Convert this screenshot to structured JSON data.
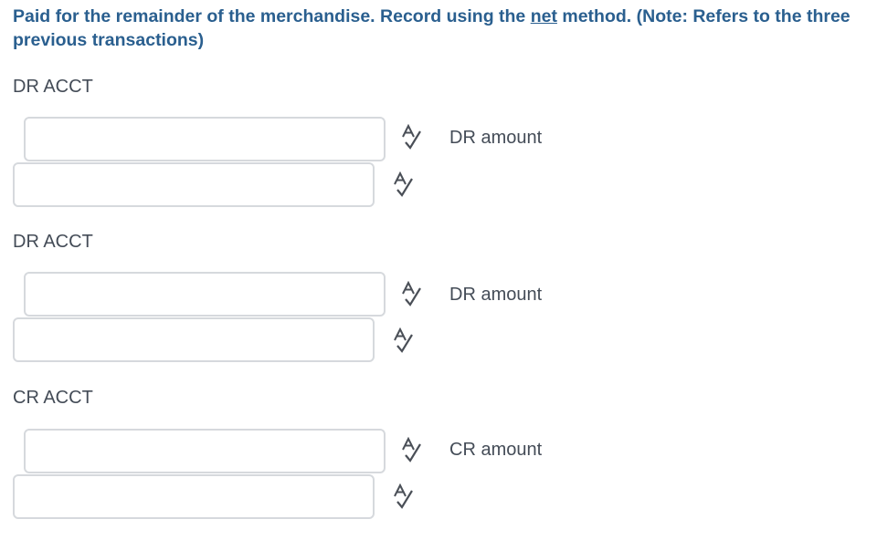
{
  "question": {
    "part1": "Paid for the remainder of the merchandise.  Record using the ",
    "underlined": "net",
    "part2": " method. (Note: Refers to the three previous transactions)"
  },
  "entries": [
    {
      "account_label": "DR ACCT",
      "account_value": "",
      "amount_label": "DR amount",
      "amount_value": ""
    },
    {
      "account_label": "DR ACCT",
      "account_value": "",
      "amount_label": "DR amount",
      "amount_value": ""
    },
    {
      "account_label": "CR ACCT",
      "account_value": "",
      "amount_label": "CR amount",
      "amount_value": ""
    }
  ],
  "icons": {
    "spellcheck": "spell-check-icon"
  }
}
